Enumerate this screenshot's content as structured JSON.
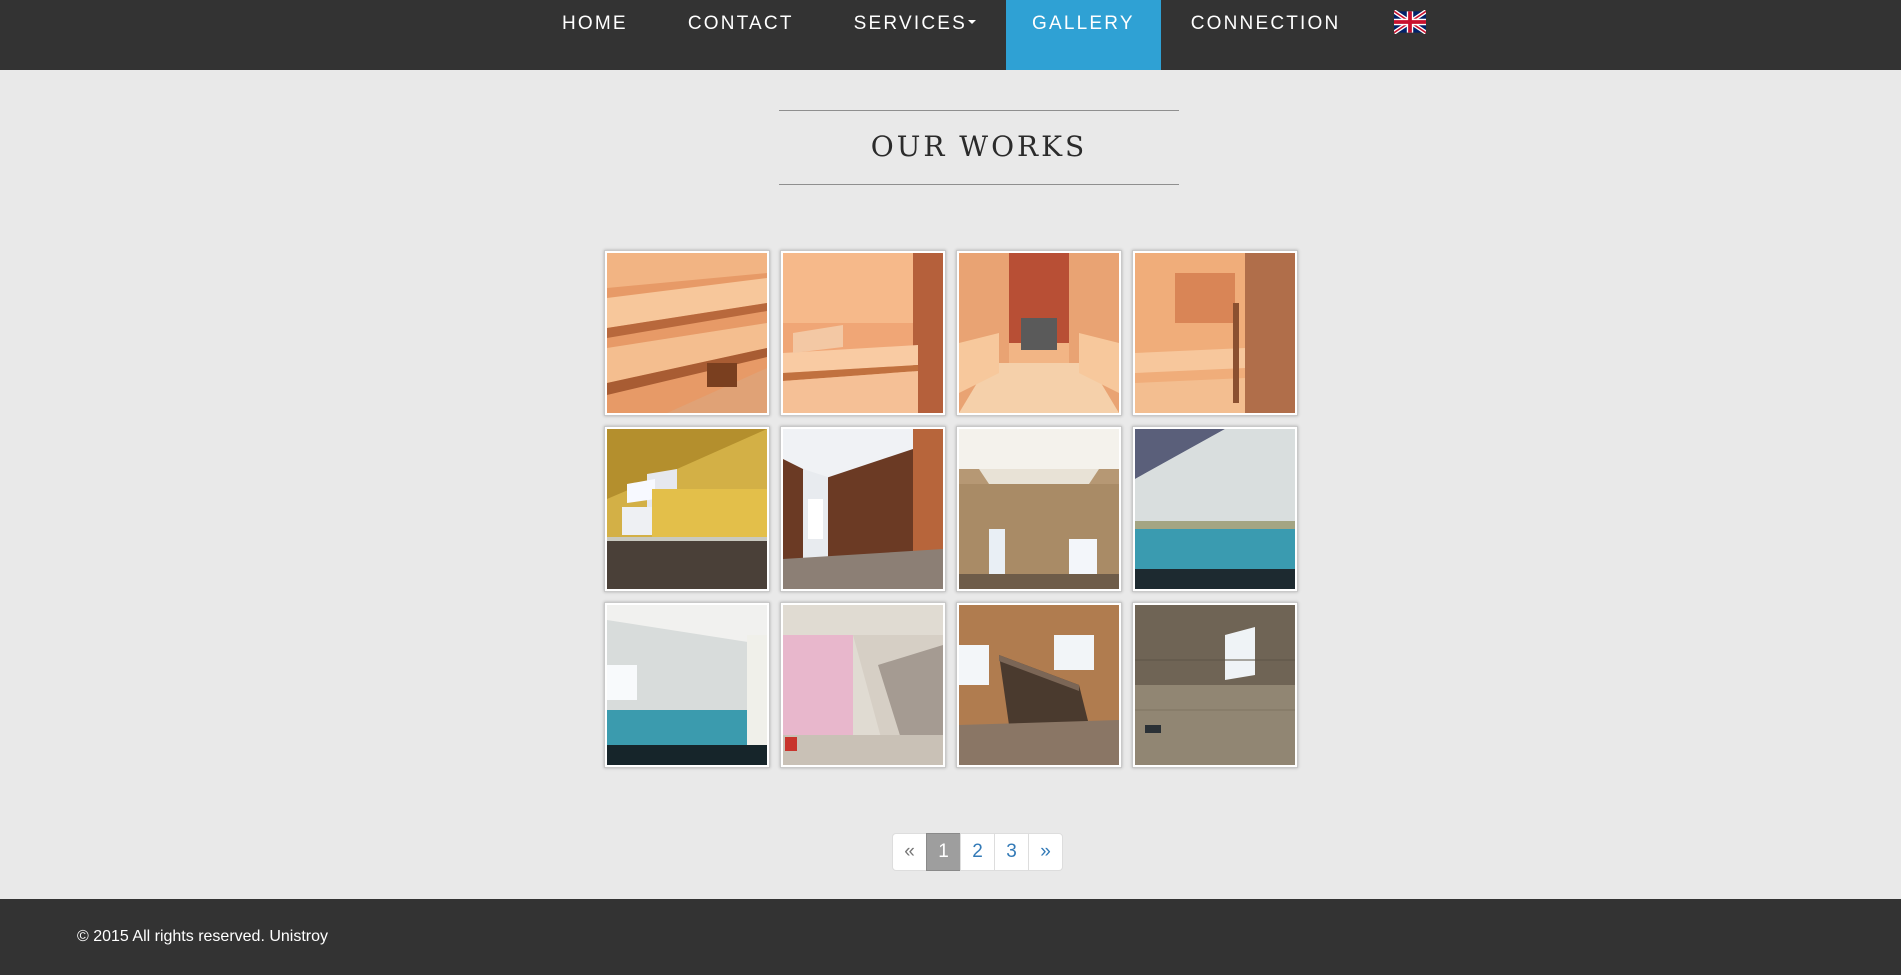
{
  "nav": {
    "items": [
      {
        "label": "HOME"
      },
      {
        "label": "CONTACT"
      },
      {
        "label": "SERVICES"
      },
      {
        "label": "GALLERY"
      },
      {
        "label": "CONNECTION"
      }
    ],
    "active_item": "GALLERY",
    "language_icon": "uk-flag-icon",
    "dropdown_icon": "caret-down-icon"
  },
  "main": {
    "title": "OUR WORKS"
  },
  "gallery": {
    "photos": [
      {
        "subject": "sauna-benches"
      },
      {
        "subject": "sauna-interior"
      },
      {
        "subject": "sauna-stove-brick-wall"
      },
      {
        "subject": "sauna-corner"
      },
      {
        "subject": "attic-room-yellow"
      },
      {
        "subject": "attic-room-brown"
      },
      {
        "subject": "room-suspended-ceiling"
      },
      {
        "subject": "attic-room-blue-tiles"
      },
      {
        "subject": "attic-room-blue-wall"
      },
      {
        "subject": "pink-room-staircase"
      },
      {
        "subject": "curved-staircase"
      },
      {
        "subject": "tiled-bathroom"
      }
    ]
  },
  "pagination": {
    "prev": "«",
    "pages": [
      "1",
      "2",
      "3"
    ],
    "next": "»",
    "current": "1"
  },
  "footer": {
    "copyright": "© 2015 All rights reserved. Unistroy"
  },
  "colors": {
    "nav_background": "#333333",
    "active_tab": "#2fa1d4",
    "page_background": "#e9e9e9",
    "link": "#337ab7"
  }
}
